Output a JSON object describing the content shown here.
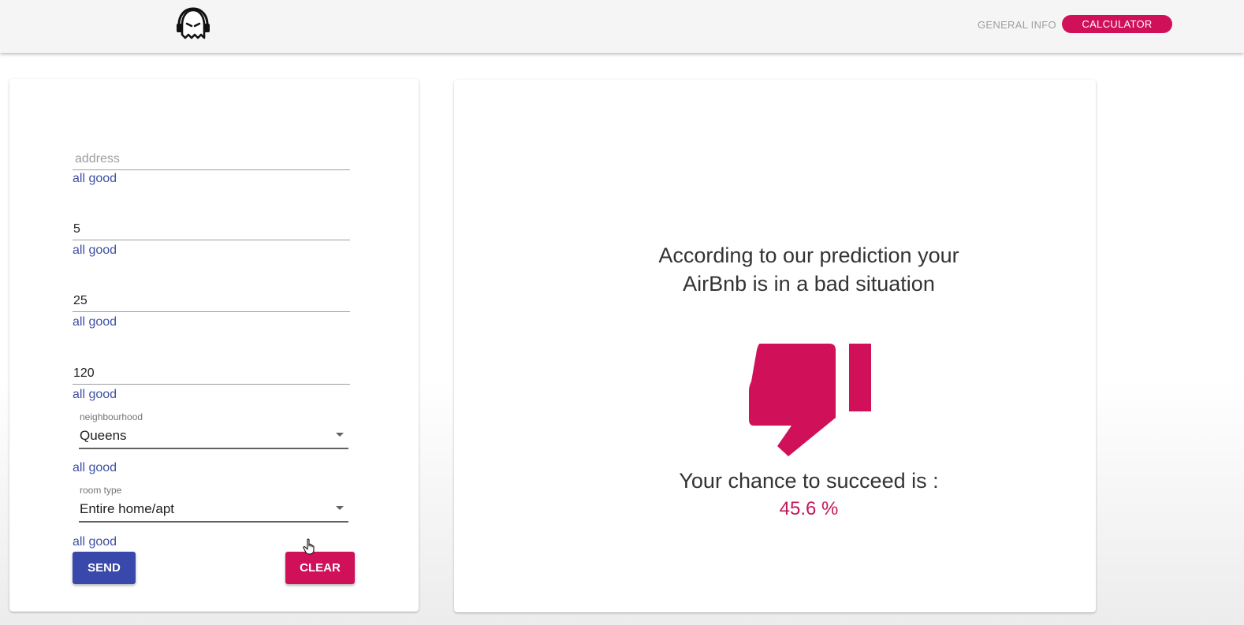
{
  "header": {
    "logo_icon": "ghost-headphones-icon",
    "nav": {
      "general_info": "GENERAL INFO",
      "calculator": "CALCULATOR"
    },
    "accent_color": "#d0115a"
  },
  "form": {
    "address": {
      "placeholder": "address",
      "value": "",
      "hint": "all good"
    },
    "field2": {
      "value": "5",
      "hint": "all good"
    },
    "field3": {
      "value": "25",
      "hint": "all good"
    },
    "field4": {
      "value": "120",
      "hint": "all good"
    },
    "neighbourhood": {
      "label": "neighbourhood",
      "value": "Queens",
      "hint": "all good"
    },
    "room_type": {
      "label": "room type",
      "value": "Entire home/apt",
      "hint": "all good"
    },
    "send_label": "SEND",
    "clear_label": "CLEAR",
    "send_color": "#3949ab"
  },
  "result": {
    "prediction_text": "According to our prediction your AirBnb is in a bad situation",
    "verdict_icon": "thumbs-down-icon",
    "chance_label": "Your chance to succeed is :",
    "chance_value": "45.6 %"
  }
}
